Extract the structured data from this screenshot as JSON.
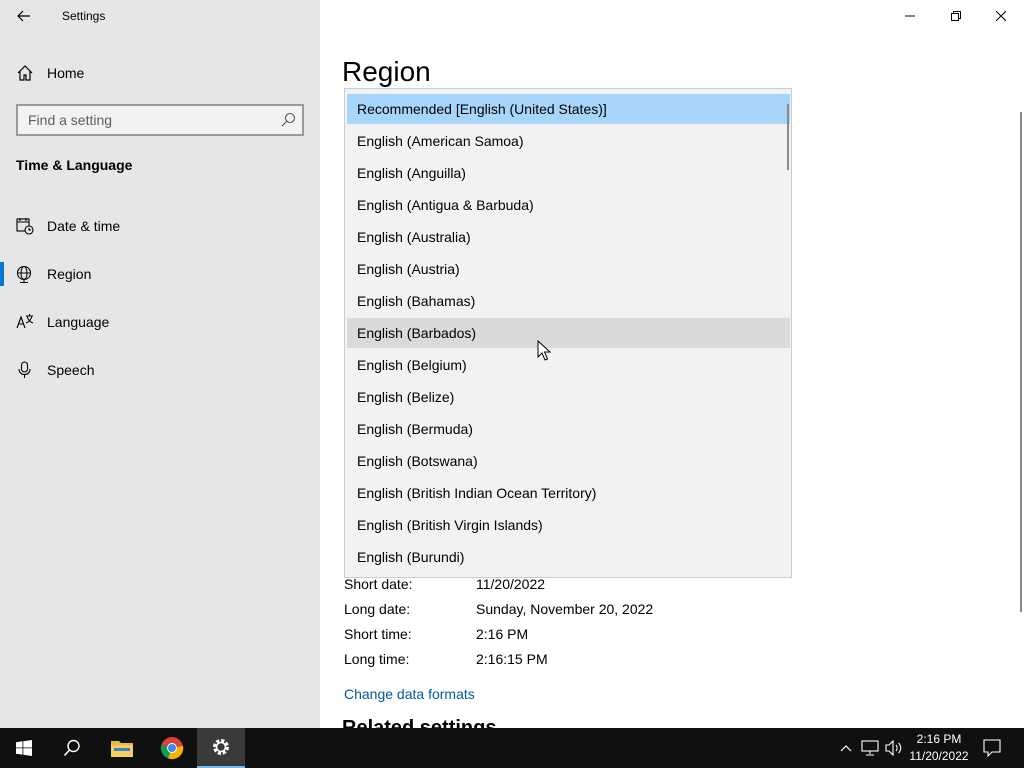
{
  "window": {
    "title": "Settings"
  },
  "sidebar": {
    "home_label": "Home",
    "search_placeholder": "Find a setting",
    "section_title": "Time & Language",
    "items": [
      {
        "label": "Date & time",
        "icon": "calendar-clock-icon"
      },
      {
        "label": "Region",
        "icon": "globe-icon",
        "active": true
      },
      {
        "label": "Language",
        "icon": "language-icon"
      },
      {
        "label": "Speech",
        "icon": "microphone-icon"
      }
    ]
  },
  "main": {
    "title": "Region",
    "formats": [
      {
        "label": "Short date:",
        "value": "11/20/2022"
      },
      {
        "label": "Long date:",
        "value": "Sunday, November 20, 2022"
      },
      {
        "label": "Short time:",
        "value": "2:16 PM"
      },
      {
        "label": "Long time:",
        "value": "2:16:15 PM"
      }
    ],
    "change_link": "Change data formats",
    "related_heading": "Related settings"
  },
  "dropdown": {
    "items": [
      "Recommended [English (United States)]",
      "English (American Samoa)",
      "English (Anguilla)",
      "English (Antigua & Barbuda)",
      "English (Australia)",
      "English (Austria)",
      "English (Bahamas)",
      "English (Barbados)",
      "English (Belgium)",
      "English (Belize)",
      "English (Bermuda)",
      "English (Botswana)",
      "English (British Indian Ocean Territory)",
      "English (British Virgin Islands)",
      "English (Burundi)"
    ],
    "selected": "Recommended [English (United States)]",
    "hovered": "English (Barbados)"
  },
  "taskbar": {
    "time": "2:16 PM",
    "date": "11/20/2022"
  },
  "colors": {
    "accent": "#0078d7",
    "selected_bg": "#a8d6fb",
    "hover_bg": "#dadada",
    "link": "#005a9e"
  }
}
